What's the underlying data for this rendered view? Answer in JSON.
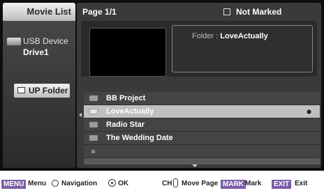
{
  "sidebar": {
    "title": "Movie List",
    "device_label": "USB Device",
    "drive_label": "Drive1",
    "up_folder_label": "UP Folder"
  },
  "header": {
    "page": "Page 1/1",
    "marked_status": "Not Marked"
  },
  "preview": {
    "folder_key": "Folder",
    "folder_sep": ":",
    "folder_value": "LoveActually"
  },
  "list": {
    "items": [
      {
        "label": "BB Project",
        "selected": false
      },
      {
        "label": "LoveActually",
        "selected": true
      },
      {
        "label": "Radio Star",
        "selected": false
      },
      {
        "label": "The Wedding Date",
        "selected": false
      }
    ]
  },
  "footer": {
    "menu_tag": "MENU",
    "menu_label": "Menu",
    "navigation_label": "Navigation",
    "ok_label": "OK",
    "ch_label": "CH",
    "move_page_label": "Move Page",
    "mark_tag": "MARK",
    "mark_label": "Mark",
    "exit_tag": "EXIT",
    "exit_label": "Exit"
  },
  "colors": {
    "tag_purple": "#7b5ea8",
    "selected_row": "#bfbfbf"
  }
}
